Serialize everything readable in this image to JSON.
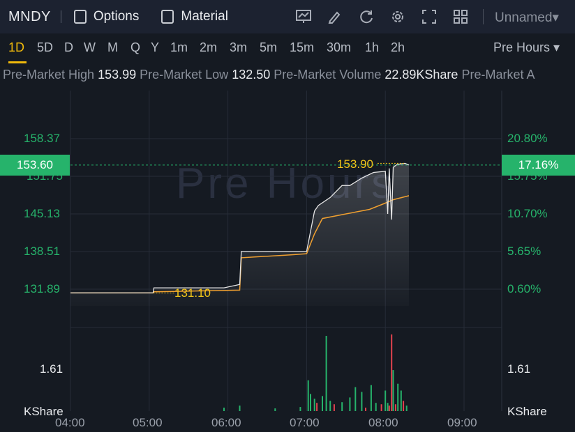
{
  "header": {
    "ticker": "MNDY",
    "options_label": "Options",
    "material_label": "Material",
    "workspace_label": "Unnamed▾"
  },
  "tools": [
    "indicators-icon",
    "draw-icon",
    "refresh-icon",
    "settings-icon",
    "fullscreen-icon",
    "layout-icon"
  ],
  "timeframes": [
    "1D",
    "5D",
    "D",
    "W",
    "M",
    "Q",
    "Y",
    "1m",
    "2m",
    "3m",
    "5m",
    "15m",
    "30m",
    "1h",
    "2h"
  ],
  "active_timeframe": "1D",
  "session_select": "Pre Hours ▾",
  "stats": {
    "high_label": "Pre-Market High",
    "high_value": "153.99",
    "low_label": "Pre-Market Low",
    "low_value": "132.50",
    "volume_label": "Pre-Market Volume",
    "volume_value": "22.89KShare",
    "trailing_label": "Pre-Market A"
  },
  "watermark": "Pre Hours",
  "colors": {
    "up": "#26b36b",
    "down": "#e2434f",
    "avg_line": "#f0a030",
    "price_line": "#e6e6e6",
    "accent": "#f0b90b"
  },
  "chart_data": {
    "type": "line",
    "x_ticks": [
      "04:00",
      "05:00",
      "06:00",
      "07:00",
      "08:00",
      "09:00"
    ],
    "y_ticks_left": [
      "158.37",
      "151.75",
      "145.13",
      "138.51",
      "131.89"
    ],
    "y_ticks_right": [
      "20.80%",
      "15.75%",
      "10.70%",
      "5.65%",
      "0.60%"
    ],
    "ylim": [
      128.8,
      161.4
    ],
    "current_price": "153.60",
    "current_change": "17.16%",
    "annotation_high": "153.90",
    "annotation_low": "131.10",
    "volume_axis_label": "1.61",
    "volume_unit": "KShare",
    "series": [
      {
        "x": [
          4.0,
          5.05,
          5.06,
          5.95,
          6.15,
          6.17,
          7.0,
          7.1,
          7.15,
          7.3,
          7.45,
          7.55,
          7.7,
          7.85,
          8.0,
          8.03,
          8.05,
          8.08,
          8.1,
          8.15,
          8.25,
          8.3
        ],
        "y": [
          131.1,
          131.1,
          132.0,
          132.0,
          132.6,
          138.4,
          138.4,
          145.5,
          146.5,
          147.9,
          150.0,
          150.0,
          151.3,
          152.3,
          152.5,
          145.0,
          153.0,
          144.0,
          153.2,
          153.7,
          153.9,
          153.6
        ]
      },
      {
        "x": [
          4.0,
          5.05,
          5.06,
          6.15,
          6.17,
          6.8,
          7.0,
          7.1,
          7.2,
          7.5,
          7.8,
          8.0,
          8.1,
          8.3
        ],
        "y": [
          131.1,
          131.1,
          131.3,
          131.6,
          137.3,
          137.8,
          138.0,
          141.5,
          144.2,
          145.0,
          145.8,
          146.9,
          147.5,
          148.2
        ]
      }
    ],
    "volume": [
      {
        "x": 5.95,
        "v": 0.05,
        "up": true
      },
      {
        "x": 6.15,
        "v": 0.08,
        "up": true
      },
      {
        "x": 6.6,
        "v": 0.04,
        "up": true
      },
      {
        "x": 6.92,
        "v": 0.06,
        "up": true
      },
      {
        "x": 7.02,
        "v": 0.45,
        "up": true
      },
      {
        "x": 7.05,
        "v": 0.25,
        "up": true
      },
      {
        "x": 7.1,
        "v": 0.18,
        "up": true
      },
      {
        "x": 7.13,
        "v": 0.12,
        "up": false
      },
      {
        "x": 7.2,
        "v": 0.22,
        "up": true
      },
      {
        "x": 7.25,
        "v": 1.1,
        "up": true
      },
      {
        "x": 7.3,
        "v": 0.15,
        "up": true
      },
      {
        "x": 7.35,
        "v": 0.1,
        "up": false
      },
      {
        "x": 7.45,
        "v": 0.13,
        "up": true
      },
      {
        "x": 7.55,
        "v": 0.2,
        "up": true
      },
      {
        "x": 7.62,
        "v": 0.35,
        "up": true
      },
      {
        "x": 7.7,
        "v": 0.28,
        "up": true
      },
      {
        "x": 7.75,
        "v": 0.05,
        "up": false
      },
      {
        "x": 7.82,
        "v": 0.38,
        "up": true
      },
      {
        "x": 7.88,
        "v": 0.12,
        "up": true
      },
      {
        "x": 7.95,
        "v": 0.1,
        "up": false
      },
      {
        "x": 8.0,
        "v": 0.3,
        "up": true
      },
      {
        "x": 8.03,
        "v": 0.12,
        "up": true
      },
      {
        "x": 8.05,
        "v": 0.08,
        "up": false
      },
      {
        "x": 8.08,
        "v": 1.12,
        "up": false
      },
      {
        "x": 8.1,
        "v": 0.6,
        "up": true
      },
      {
        "x": 8.13,
        "v": 0.1,
        "up": false
      },
      {
        "x": 8.16,
        "v": 0.4,
        "up": true
      },
      {
        "x": 8.2,
        "v": 0.3,
        "up": true
      },
      {
        "x": 8.23,
        "v": 0.15,
        "up": false
      },
      {
        "x": 8.27,
        "v": 0.08,
        "up": true
      }
    ]
  }
}
